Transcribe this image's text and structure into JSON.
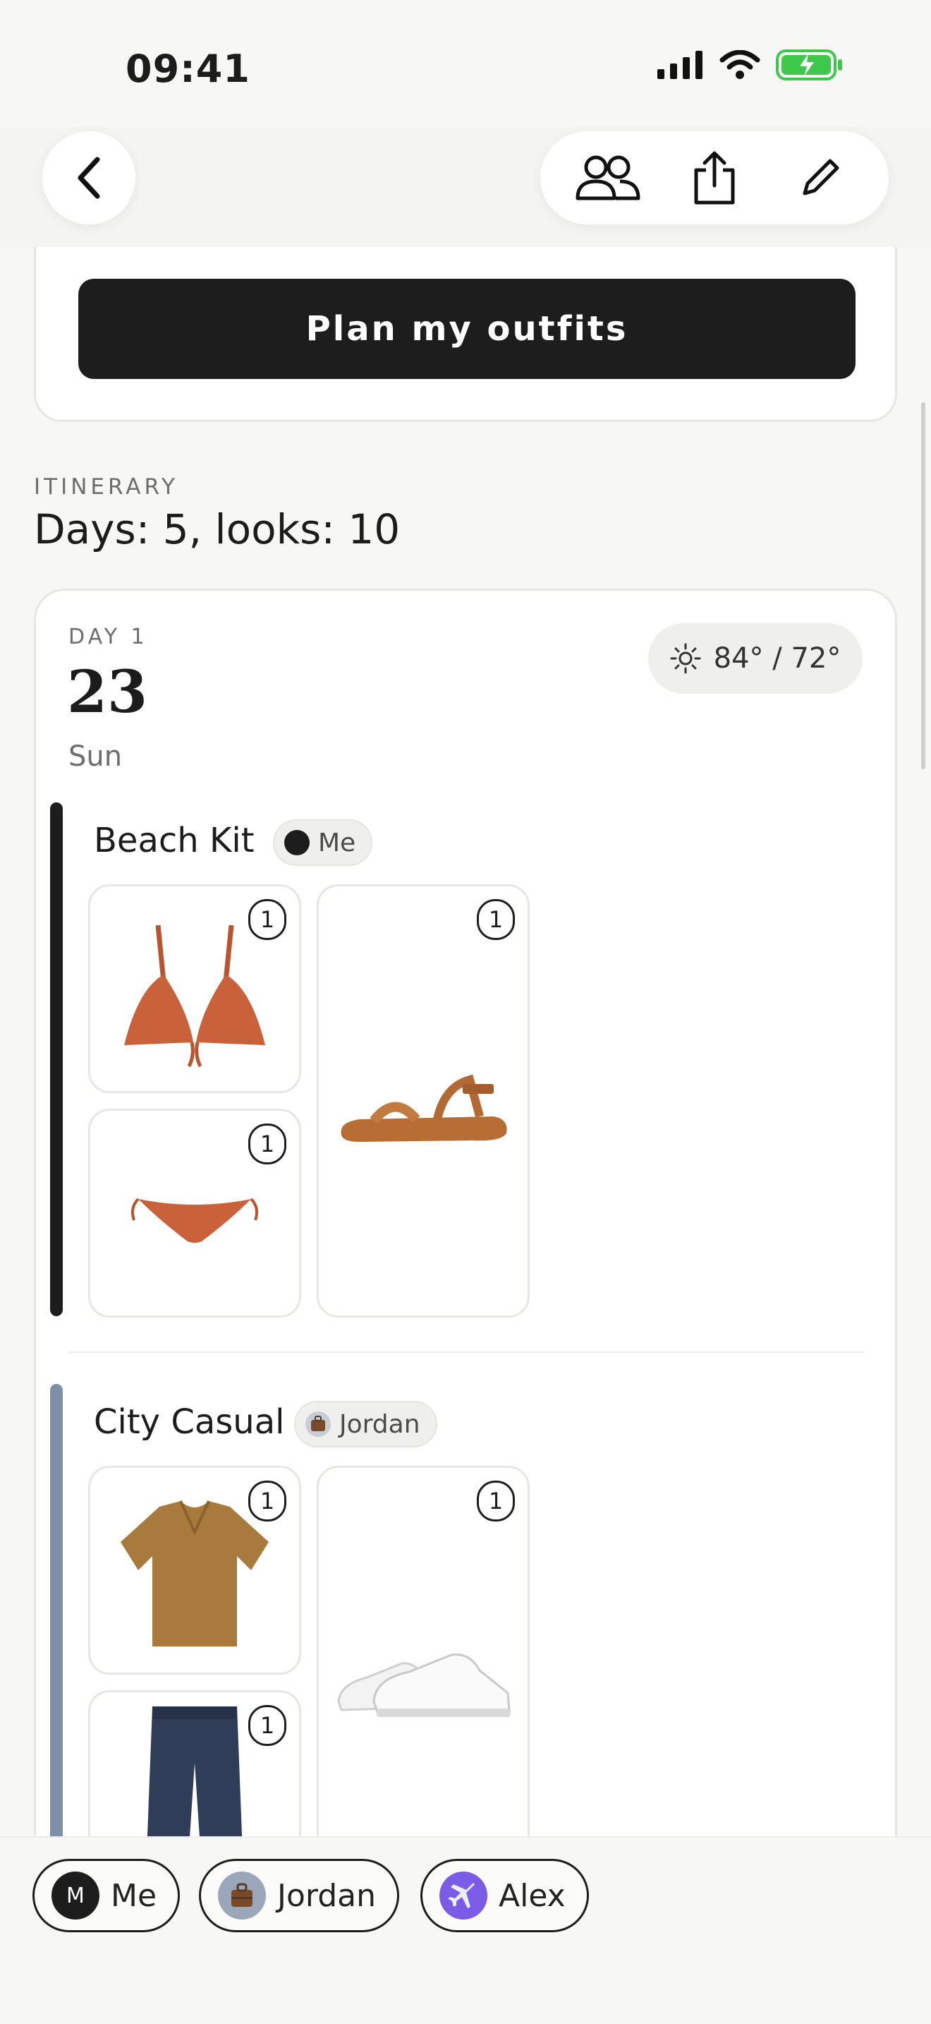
{
  "status": {
    "time": "09:41"
  },
  "header": {
    "back_icon": "chevron-left-icon",
    "actions": [
      "people-icon",
      "share-icon",
      "pencil-icon"
    ]
  },
  "plan": {
    "button_label": "Plan my outfits"
  },
  "itinerary": {
    "kicker": "ITINERARY",
    "title": "Days: 5, looks: 10"
  },
  "day": {
    "kicker": "DAY 1",
    "number": "23",
    "weekday": "Sun",
    "weather": {
      "icon": "sun-icon",
      "text": "84° / 72°"
    }
  },
  "looks": [
    {
      "title": "Beach Kit",
      "owner": "Me",
      "bar_color": "#1d1d1d",
      "items": [
        {
          "name": "bikini-top",
          "qty": "1"
        },
        {
          "name": "sandal",
          "qty": "1"
        },
        {
          "name": "bikini-bottom",
          "qty": "1"
        }
      ]
    },
    {
      "title": "City Casual",
      "owner": "Jordan",
      "bar_color": "#7e8fa8",
      "items": [
        {
          "name": "polo-shirt",
          "qty": "1"
        },
        {
          "name": "sneakers",
          "qty": "1"
        },
        {
          "name": "jeans",
          "qty": "1"
        }
      ]
    }
  ],
  "people": [
    {
      "name": "Me",
      "initial": "M"
    },
    {
      "name": "Jordan"
    },
    {
      "name": "Alex"
    }
  ],
  "colors": {
    "accent_dark": "#1d1d1d",
    "look2_bar": "#7e8fa8",
    "battery": "#3ec84b"
  }
}
